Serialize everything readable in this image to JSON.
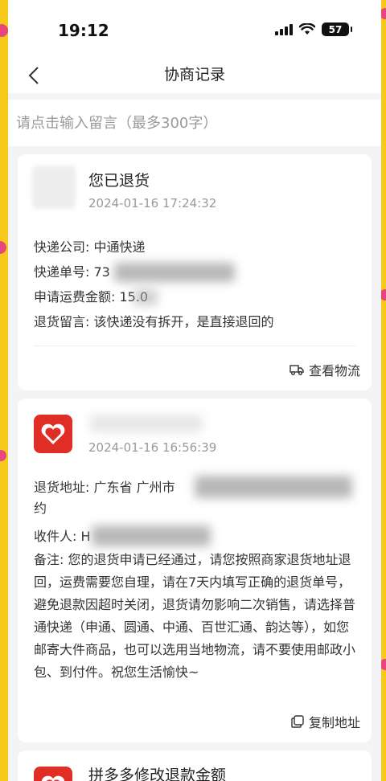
{
  "status_bar": {
    "time": "19:12",
    "battery": "57"
  },
  "nav": {
    "title": "协商记录"
  },
  "message": {
    "placeholder": "请点击输入留言（最多300字）"
  },
  "cards": [
    {
      "title": "您已退货",
      "time": "2024-01-16 17:24:32",
      "lines": [
        "快递公司: 中通快递",
        "快递单号: 73",
        "申请运费金额: 15.0",
        "退货留言: 该快递没有拆开，是直接退回的"
      ],
      "action": "查看物流",
      "action_icon": "truck-icon"
    },
    {
      "time": "2024-01-16 16:56:39",
      "address_line1": "退货地址: 广东省 广州市",
      "address_line2": "约",
      "recipient": "收件人: H",
      "note": "备注: 您的退货申请已经通过，请您按照商家退货地址退回，运费需要您自理，请在7天内填写正确的退货单号，避免退款因超时关闭，退货请勿影响二次销售，请选择普通快递（申通、圆通、中通、百世汇通、韵达等），如您邮寄大件商品，也可以选用当地物流，请不要使用邮政小包、到付件。祝您生活愉快~",
      "action": "复制地址",
      "action_icon": "copy-icon"
    },
    {
      "title": "拼多多修改退款金额"
    }
  ],
  "colors": {
    "brand": "#e02e24",
    "frame": "#f7c91a",
    "accent_pink": "#e8457e"
  }
}
